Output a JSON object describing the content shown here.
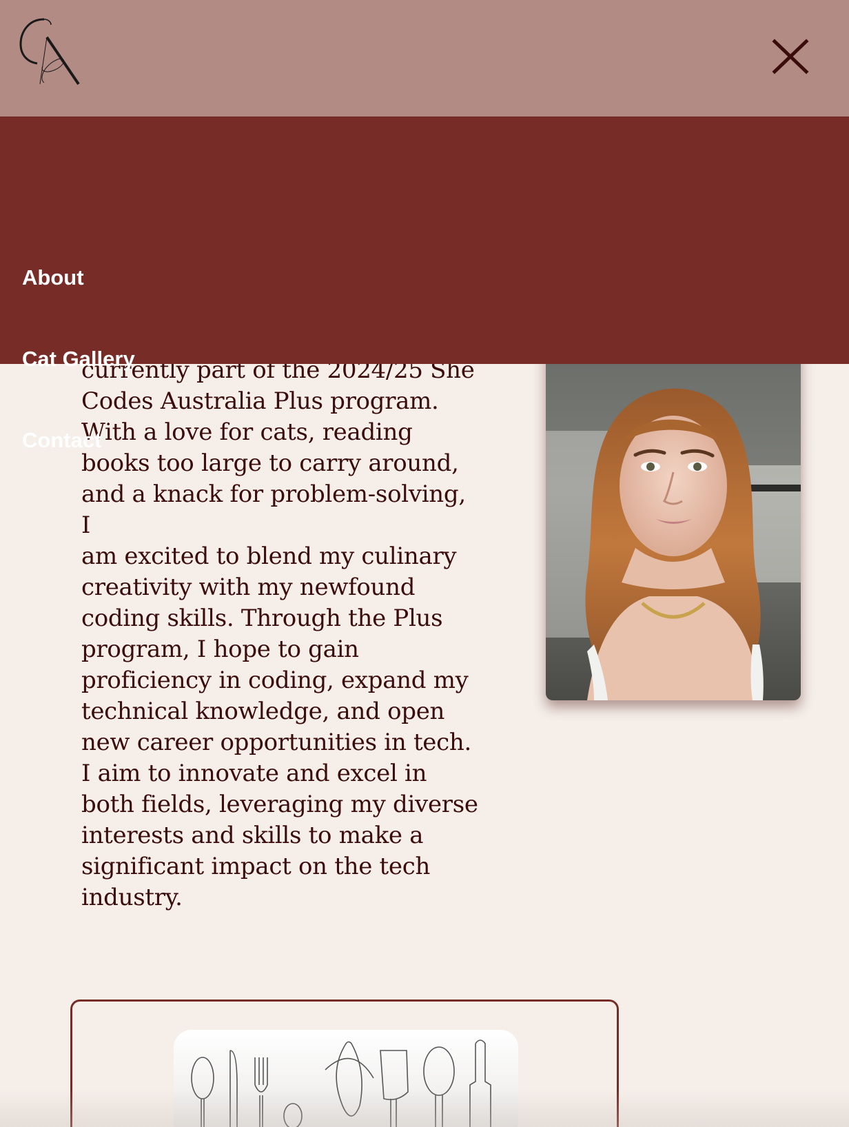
{
  "header": {
    "logo_icon": "ca-monogram-logo",
    "close_icon": "close-icon",
    "colors": {
      "header_bg": "#b38b85",
      "menu_bg": "#772c27",
      "text_dark": "#3a0c0c",
      "page_bg": "#f5eee9"
    }
  },
  "menu": {
    "items": [
      {
        "label": "About"
      },
      {
        "label": "Cat Gallery"
      },
      {
        "label": "Contact"
      }
    ]
  },
  "bio": {
    "lines": [
      "currently part of the 2024/25 She",
      "Codes Australia Plus program.",
      "With a love for cats, reading",
      "books too large to carry around,",
      "and a knack for problem-solving, I",
      "am excited to blend my culinary",
      "creativity with my newfound",
      "coding skills. Through the Plus",
      "program, I hope to gain",
      "proficiency in coding, expand my",
      "technical knowledge, and open",
      "new career opportunities in tech.",
      "I aim to innovate and excel in",
      "both fields, leveraging my diverse",
      "interests and skills to make a",
      "significant impact on the tech",
      "industry."
    ]
  },
  "portrait": {
    "icon": "portrait-photo"
  },
  "card": {
    "icon": "kitchen-utensils-illustration"
  }
}
